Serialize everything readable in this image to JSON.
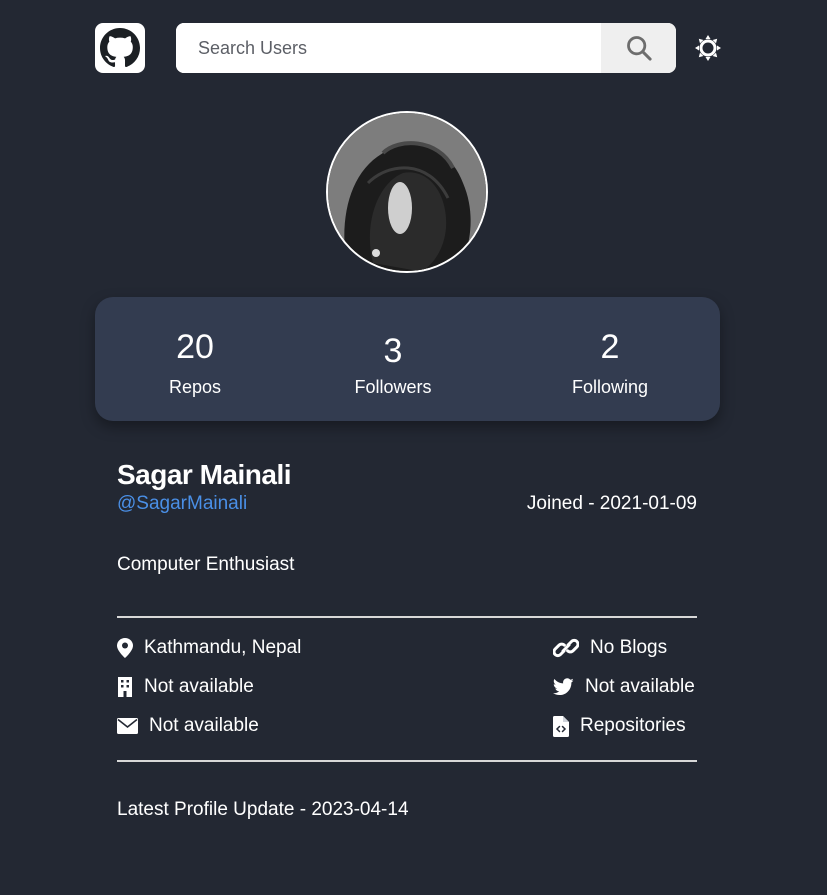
{
  "header": {
    "logo_icon": "github-icon",
    "search": {
      "placeholder": "Search Users",
      "value": ""
    },
    "search_button_icon": "search-icon",
    "theme_toggle_icon": "sun-icon"
  },
  "profile": {
    "avatar_alt": "user-avatar",
    "stats": [
      {
        "value": "20",
        "label": "Repos"
      },
      {
        "value": "3",
        "label": "Followers"
      },
      {
        "value": "2",
        "label": "Following"
      }
    ],
    "name": "Sagar Mainali",
    "handle": "@SagarMainali",
    "joined": "Joined - 2021-01-09",
    "bio": "Computer Enthusiast",
    "info_left": [
      {
        "icon": "location-pin-icon",
        "text": "Kathmandu, Nepal"
      },
      {
        "icon": "building-icon",
        "text": "Not available"
      },
      {
        "icon": "envelope-icon",
        "text": "Not available"
      }
    ],
    "info_right": [
      {
        "icon": "link-icon",
        "text": "No Blogs"
      },
      {
        "icon": "twitter-icon",
        "text": "Not available"
      },
      {
        "icon": "code-file-icon",
        "text": "Repositories"
      }
    ],
    "last_update": "Latest Profile Update - 2023-04-14"
  },
  "colors": {
    "background": "#232833",
    "card": "#333c50",
    "accent": "#4a8fe6",
    "text": "#ffffff"
  }
}
